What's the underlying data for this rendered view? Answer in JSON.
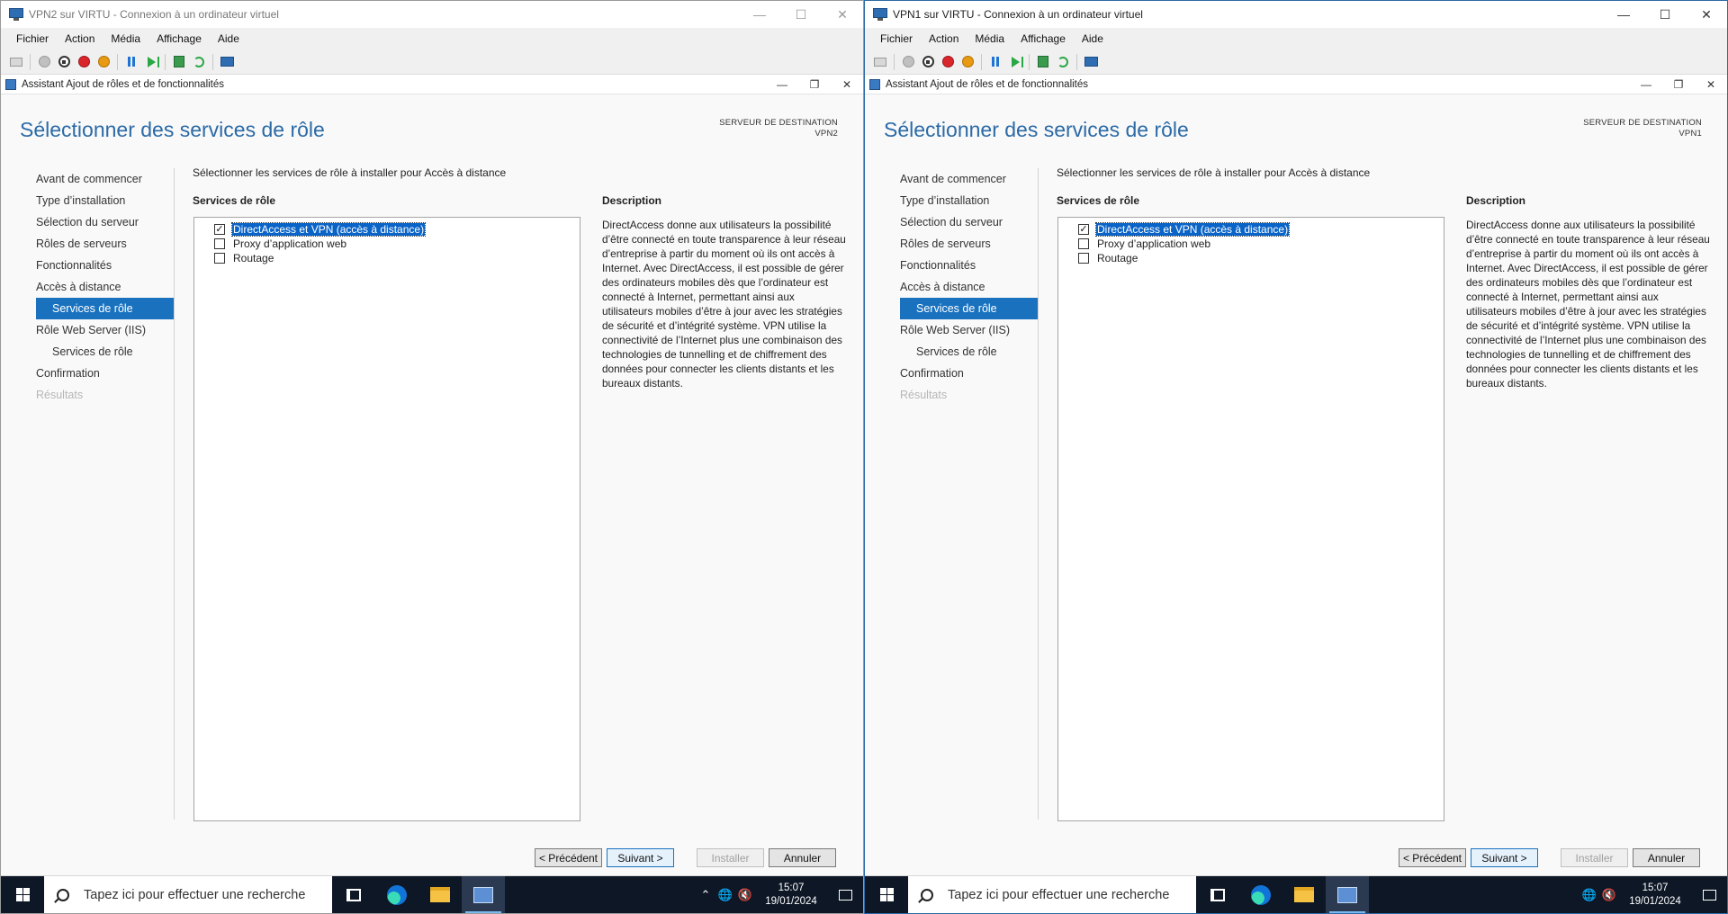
{
  "windows": [
    {
      "id": "vpn2",
      "title": "VPN2 sur VIRTU - Connexion à un ordinateur virtuel",
      "active": false,
      "menu": [
        "Fichier",
        "Action",
        "Média",
        "Affichage",
        "Aide"
      ],
      "wizard": {
        "title": "Assistant Ajout de rôles et de fonctionnalités",
        "heading": "Sélectionner des services de rôle",
        "dest_label": "SERVEUR DE DESTINATION",
        "dest_server": "VPN2",
        "nav": [
          {
            "label": "Avant de commencer",
            "state": "normal",
            "sub": false
          },
          {
            "label": "Type d’installation",
            "state": "normal",
            "sub": false
          },
          {
            "label": "Sélection du serveur",
            "state": "normal",
            "sub": false
          },
          {
            "label": "Rôles de serveurs",
            "state": "normal",
            "sub": false
          },
          {
            "label": "Fonctionnalités",
            "state": "normal",
            "sub": false
          },
          {
            "label": "Accès à distance",
            "state": "normal",
            "sub": false
          },
          {
            "label": "Services de rôle",
            "state": "active",
            "sub": true
          },
          {
            "label": "Rôle Web Server (IIS)",
            "state": "normal",
            "sub": false
          },
          {
            "label": "Services de rôle",
            "state": "normal",
            "sub": true
          },
          {
            "label": "Confirmation",
            "state": "normal",
            "sub": false
          },
          {
            "label": "Résultats",
            "state": "disabled",
            "sub": false
          }
        ],
        "instruction": "Sélectionner les services de rôle à installer pour Accès à distance",
        "services_label": "Services de rôle",
        "services": [
          {
            "label": "DirectAccess et VPN (accès à distance)",
            "checked": true,
            "selected": true
          },
          {
            "label": "Proxy d’application web",
            "checked": false,
            "selected": false
          },
          {
            "label": "Routage",
            "checked": false,
            "selected": false
          }
        ],
        "description_label": "Description",
        "description": "DirectAccess donne aux utilisateurs la possibilité d’être connecté en toute transparence à leur réseau d’entreprise à partir du moment où ils ont accès à Internet. Avec DirectAccess, il est possible de gérer des ordinateurs mobiles dès que l’ordinateur est connecté à Internet, permettant ainsi aux utilisateurs mobiles d’être à jour avec les stratégies de sécurité et d’intégrité système. VPN utilise la connectivité de l’Internet plus une combinaison des technologies de tunnelling et de chiffrement des données pour connecter les clients distants et les bureaux distants.",
        "buttons": {
          "prev": "< Précédent",
          "next": "Suivant >",
          "install": "Installer",
          "cancel": "Annuler"
        }
      },
      "taskbar": {
        "search_placeholder": "Tapez ici pour effectuer une recherche",
        "time": "15:07",
        "date": "19/01/2024"
      }
    },
    {
      "id": "vpn1",
      "title": "VPN1 sur VIRTU - Connexion à un ordinateur virtuel",
      "active": true,
      "menu": [
        "Fichier",
        "Action",
        "Média",
        "Affichage",
        "Aide"
      ],
      "wizard": {
        "title": "Assistant Ajout de rôles et de fonctionnalités",
        "heading": "Sélectionner des services de rôle",
        "dest_label": "SERVEUR DE DESTINATION",
        "dest_server": "VPN1",
        "nav": [
          {
            "label": "Avant de commencer",
            "state": "normal",
            "sub": false
          },
          {
            "label": "Type d’installation",
            "state": "normal",
            "sub": false
          },
          {
            "label": "Sélection du serveur",
            "state": "normal",
            "sub": false
          },
          {
            "label": "Rôles de serveurs",
            "state": "normal",
            "sub": false
          },
          {
            "label": "Fonctionnalités",
            "state": "normal",
            "sub": false
          },
          {
            "label": "Accès à distance",
            "state": "normal",
            "sub": false
          },
          {
            "label": "Services de rôle",
            "state": "active",
            "sub": true
          },
          {
            "label": "Rôle Web Server (IIS)",
            "state": "normal",
            "sub": false
          },
          {
            "label": "Services de rôle",
            "state": "normal",
            "sub": true
          },
          {
            "label": "Confirmation",
            "state": "normal",
            "sub": false
          },
          {
            "label": "Résultats",
            "state": "disabled",
            "sub": false
          }
        ],
        "instruction": "Sélectionner les services de rôle à installer pour Accès à distance",
        "services_label": "Services de rôle",
        "services": [
          {
            "label": "DirectAccess et VPN (accès à distance)",
            "checked": true,
            "selected": true
          },
          {
            "label": "Proxy d’application web",
            "checked": false,
            "selected": false
          },
          {
            "label": "Routage",
            "checked": false,
            "selected": false
          }
        ],
        "description_label": "Description",
        "description": "DirectAccess donne aux utilisateurs la possibilité d’être connecté en toute transparence à leur réseau d’entreprise à partir du moment où ils ont accès à Internet. Avec DirectAccess, il est possible de gérer des ordinateurs mobiles dès que l’ordinateur est connecté à Internet, permettant ainsi aux utilisateurs mobiles d’être à jour avec les stratégies de sécurité et d’intégrité système. VPN utilise la connectivité de l’Internet plus une combinaison des technologies de tunnelling et de chiffrement des données pour connecter les clients distants et les bureaux distants.",
        "buttons": {
          "prev": "< Précédent",
          "next": "Suivant >",
          "install": "Installer",
          "cancel": "Annuler"
        }
      },
      "taskbar": {
        "search_placeholder": "Tapez ici pour effectuer une recherche",
        "time": "15:07",
        "date": "19/01/2024"
      }
    }
  ],
  "colors": {
    "heading": "#2b6aa6",
    "nav_active": "#1a72bf",
    "taskbar": "#0e1726",
    "selection": "#0a64c8"
  },
  "icons": {
    "window_controls": [
      "minimize-icon",
      "maximize-icon",
      "close-icon"
    ],
    "toolbar": [
      "ctrl-alt-del-icon",
      "start-icon",
      "turn-off-icon",
      "shutdown-icon",
      "save-icon",
      "pause-icon",
      "reset-icon",
      "checkpoint-icon",
      "revert-icon",
      "enhanced-session-icon"
    ],
    "taskbar": [
      "windows-start-icon",
      "search-icon",
      "task-view-icon",
      "edge-icon",
      "file-explorer-icon",
      "hyper-v-connection-icon",
      "chevron-up-icon",
      "network-globe-icon",
      "volume-muted-icon",
      "notification-icon"
    ]
  }
}
